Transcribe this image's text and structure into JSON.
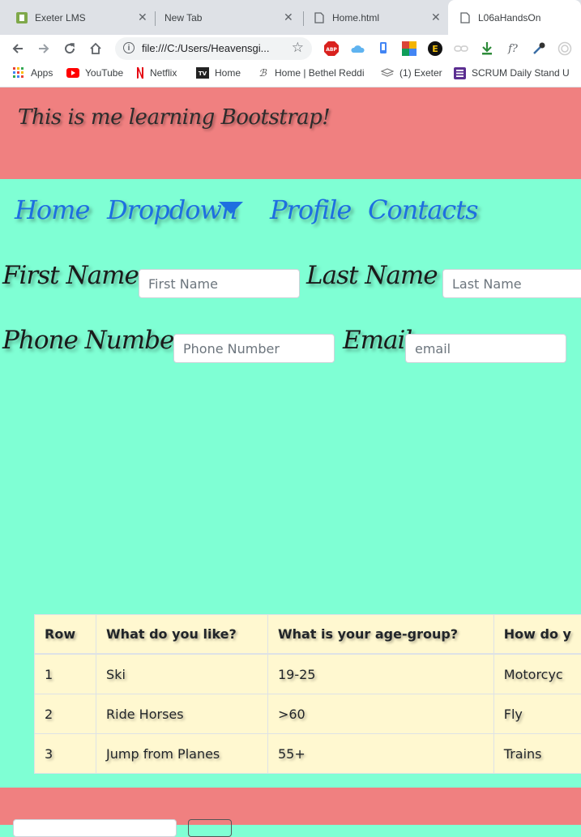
{
  "browser": {
    "tabs": [
      {
        "title": "Exeter LMS",
        "active": false
      },
      {
        "title": "New Tab",
        "active": false
      },
      {
        "title": "Home.html",
        "active": false
      },
      {
        "title": "L06aHandsOn",
        "active": true
      }
    ],
    "address": "file:///C:/Users/Heavensgi...",
    "bookmarks": [
      "Apps",
      "YouTube",
      "Netflix",
      "Home",
      "Home | Bethel Reddi",
      "(1) Exeter",
      "SCRUM Daily Stand U"
    ],
    "extensions": {
      "abp": "ABP",
      "f": "f?"
    }
  },
  "header": {
    "title": "This is me learning Bootstrap!"
  },
  "nav": {
    "home": "Home",
    "dropdown": "Dropdown",
    "profile": "Profile",
    "contacts": "Contacts"
  },
  "form": {
    "first_name_label": "First Name",
    "first_name_placeholder": "First Name",
    "last_name_label": "Last Name",
    "last_name_placeholder": "Last Name",
    "phone_label": "Phone Number",
    "phone_placeholder": "Phone Number",
    "email_label": "Email",
    "email_placeholder": "email"
  },
  "table": {
    "headers": [
      "Row",
      "What do you like?",
      "What is your age-group?",
      "How do y"
    ],
    "rows": [
      [
        "1",
        "Ski",
        "19-25",
        "Motorcyc"
      ],
      [
        "2",
        "Ride Horses",
        ">60",
        "Fly"
      ],
      [
        "3",
        "Jump from Planes",
        "55+",
        "Trains"
      ]
    ]
  },
  "colors": {
    "header_bg": "#f08080",
    "body_bg": "#7fffd4",
    "table_bg": "#fff8d0",
    "nav_link": "#1e6fe0"
  }
}
